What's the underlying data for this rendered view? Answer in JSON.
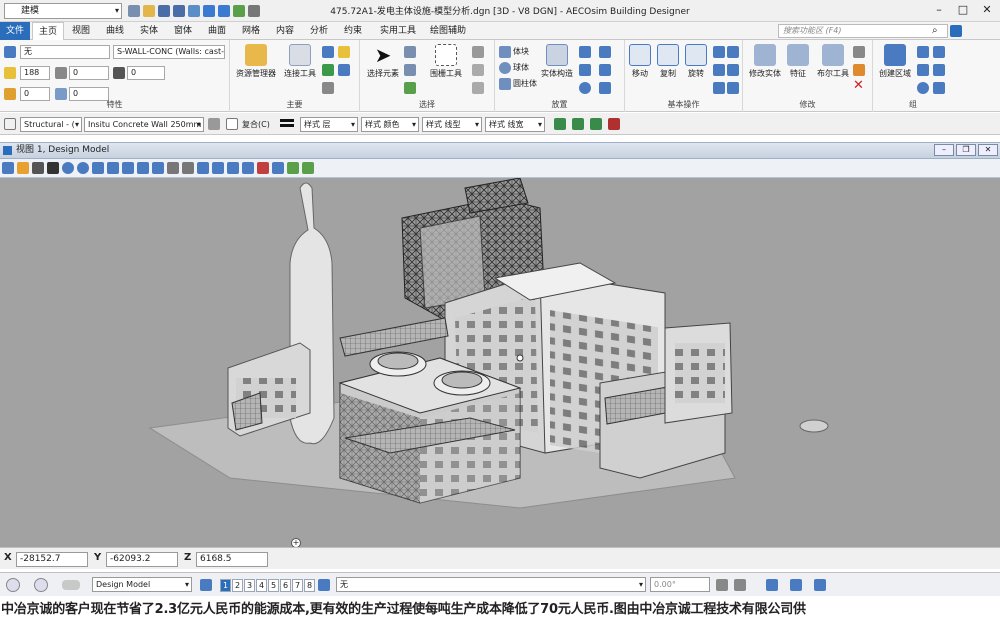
{
  "titlebar": {
    "workspace": "建模",
    "title": "475.72A1-发电主体设施-模型分析.dgn [3D - V8 DGN] - AECOsim Building Designer"
  },
  "tabs": [
    "文件",
    "主页",
    "视图",
    "曲线",
    "实体",
    "窗体",
    "曲面",
    "网格",
    "内容",
    "分析",
    "约束",
    "实用工具",
    "绘图辅助"
  ],
  "active_tab": "主页",
  "search": {
    "placeholder": "搜索功能区 (F4)"
  },
  "ribbon": {
    "properties": {
      "label": "特性",
      "level": "无",
      "element_template": "S-WALL-CONC (Walls: cast-in",
      "color": "188",
      "style": "0",
      "weight": "0",
      "transparency": "0",
      "priority": "0"
    },
    "primary": {
      "label": "主要",
      "explorer": "资源管理器",
      "attach_tools": "连接工具"
    },
    "selection": {
      "label": "选择",
      "select_element": "选择元素",
      "fence_tools": "围栅工具"
    },
    "placement": {
      "label": "放置",
      "solid": "体块",
      "sphere": "球体",
      "cylinder": "圆柱体",
      "solid_construct": "实体构造"
    },
    "manipulate": {
      "label": "基本操作",
      "move": "移动",
      "copy": "复制",
      "rotate": "旋转"
    },
    "modify": {
      "label": "修改",
      "modify_solid": "修改实体",
      "feature": "特征",
      "boolean_tools": "布尔工具"
    },
    "group": {
      "label": "组",
      "create_region": "创建区域"
    }
  },
  "attrbar": {
    "family": "Structural - (",
    "part": "Insitu Concrete Wall 250mm",
    "composite": "复合(C)",
    "style_level": "样式 层",
    "style_color": "样式 颜色",
    "style_linestyle": "样式 线型",
    "style_weight": "样式 线宽"
  },
  "view": {
    "title": "视图 1, Design Model"
  },
  "coords": {
    "x_label": "X",
    "x": "-28152.7",
    "y_label": "Y",
    "y": "-62093.2",
    "z_label": "Z",
    "z": "6168.5"
  },
  "statusbar": {
    "model": "Design Model",
    "pages": [
      "1",
      "2",
      "3",
      "4",
      "5",
      "6",
      "7",
      "8"
    ],
    "active_page": "1",
    "level": "无",
    "angle": "0.00°"
  },
  "caption": "中冶京诚的客户现在节省了2.3亿元人民币的能源成本,更有效的生产过程使每吨生产成本降低了70元人民币.图由中冶京诚工程技术有限公司供",
  "colors": {
    "accent": "#2a6ebb",
    "viewport_bg": "#a2a2a2"
  }
}
